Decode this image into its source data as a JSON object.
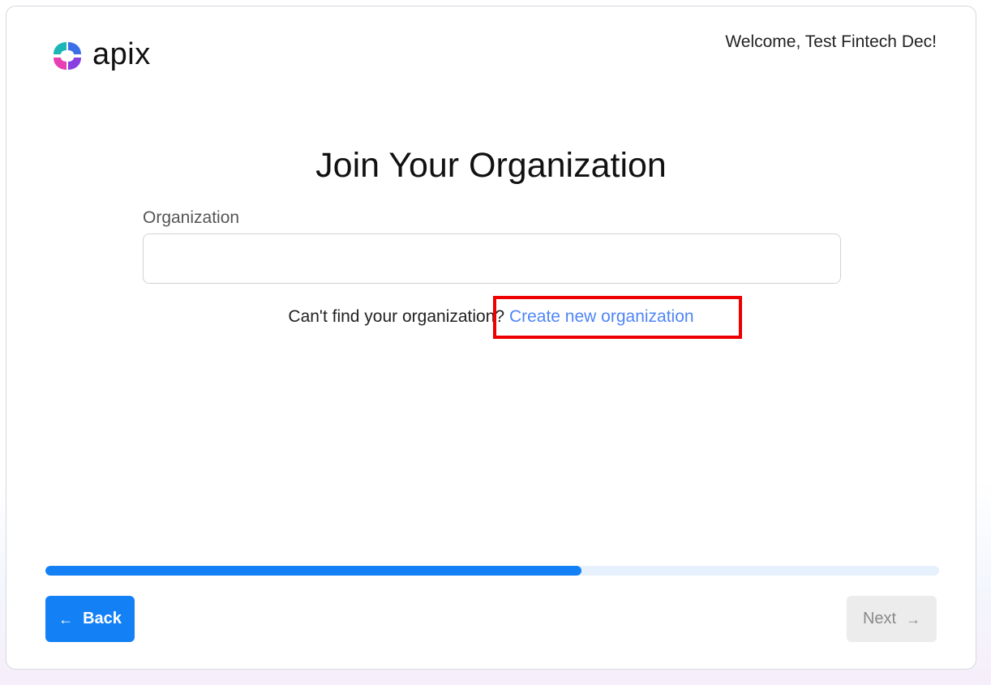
{
  "brand": {
    "name": "apix",
    "colors": {
      "teal": "#1bb7b6",
      "blue": "#3a6fe8",
      "purple": "#8a3fe0",
      "pink": "#e83fb5"
    }
  },
  "header": {
    "welcome": "Welcome, Test Fintech Dec!"
  },
  "main": {
    "title": "Join Your Organization",
    "organization_field": {
      "label": "Organization",
      "value": "",
      "placeholder": ""
    },
    "helper": {
      "text": "Can't find your organization?",
      "link_label": "Create new organization"
    }
  },
  "progress": {
    "fraction": 0.6
  },
  "footer": {
    "back_label": "Back",
    "back_icon": "arrow-left-icon",
    "next_label": "Next",
    "next_icon": "arrow-right-icon",
    "next_disabled": true
  },
  "colors": {
    "accent": "#1480f5",
    "link": "#4f86f7",
    "highlight": "#ee0000",
    "disabled_bg": "#ececec"
  }
}
